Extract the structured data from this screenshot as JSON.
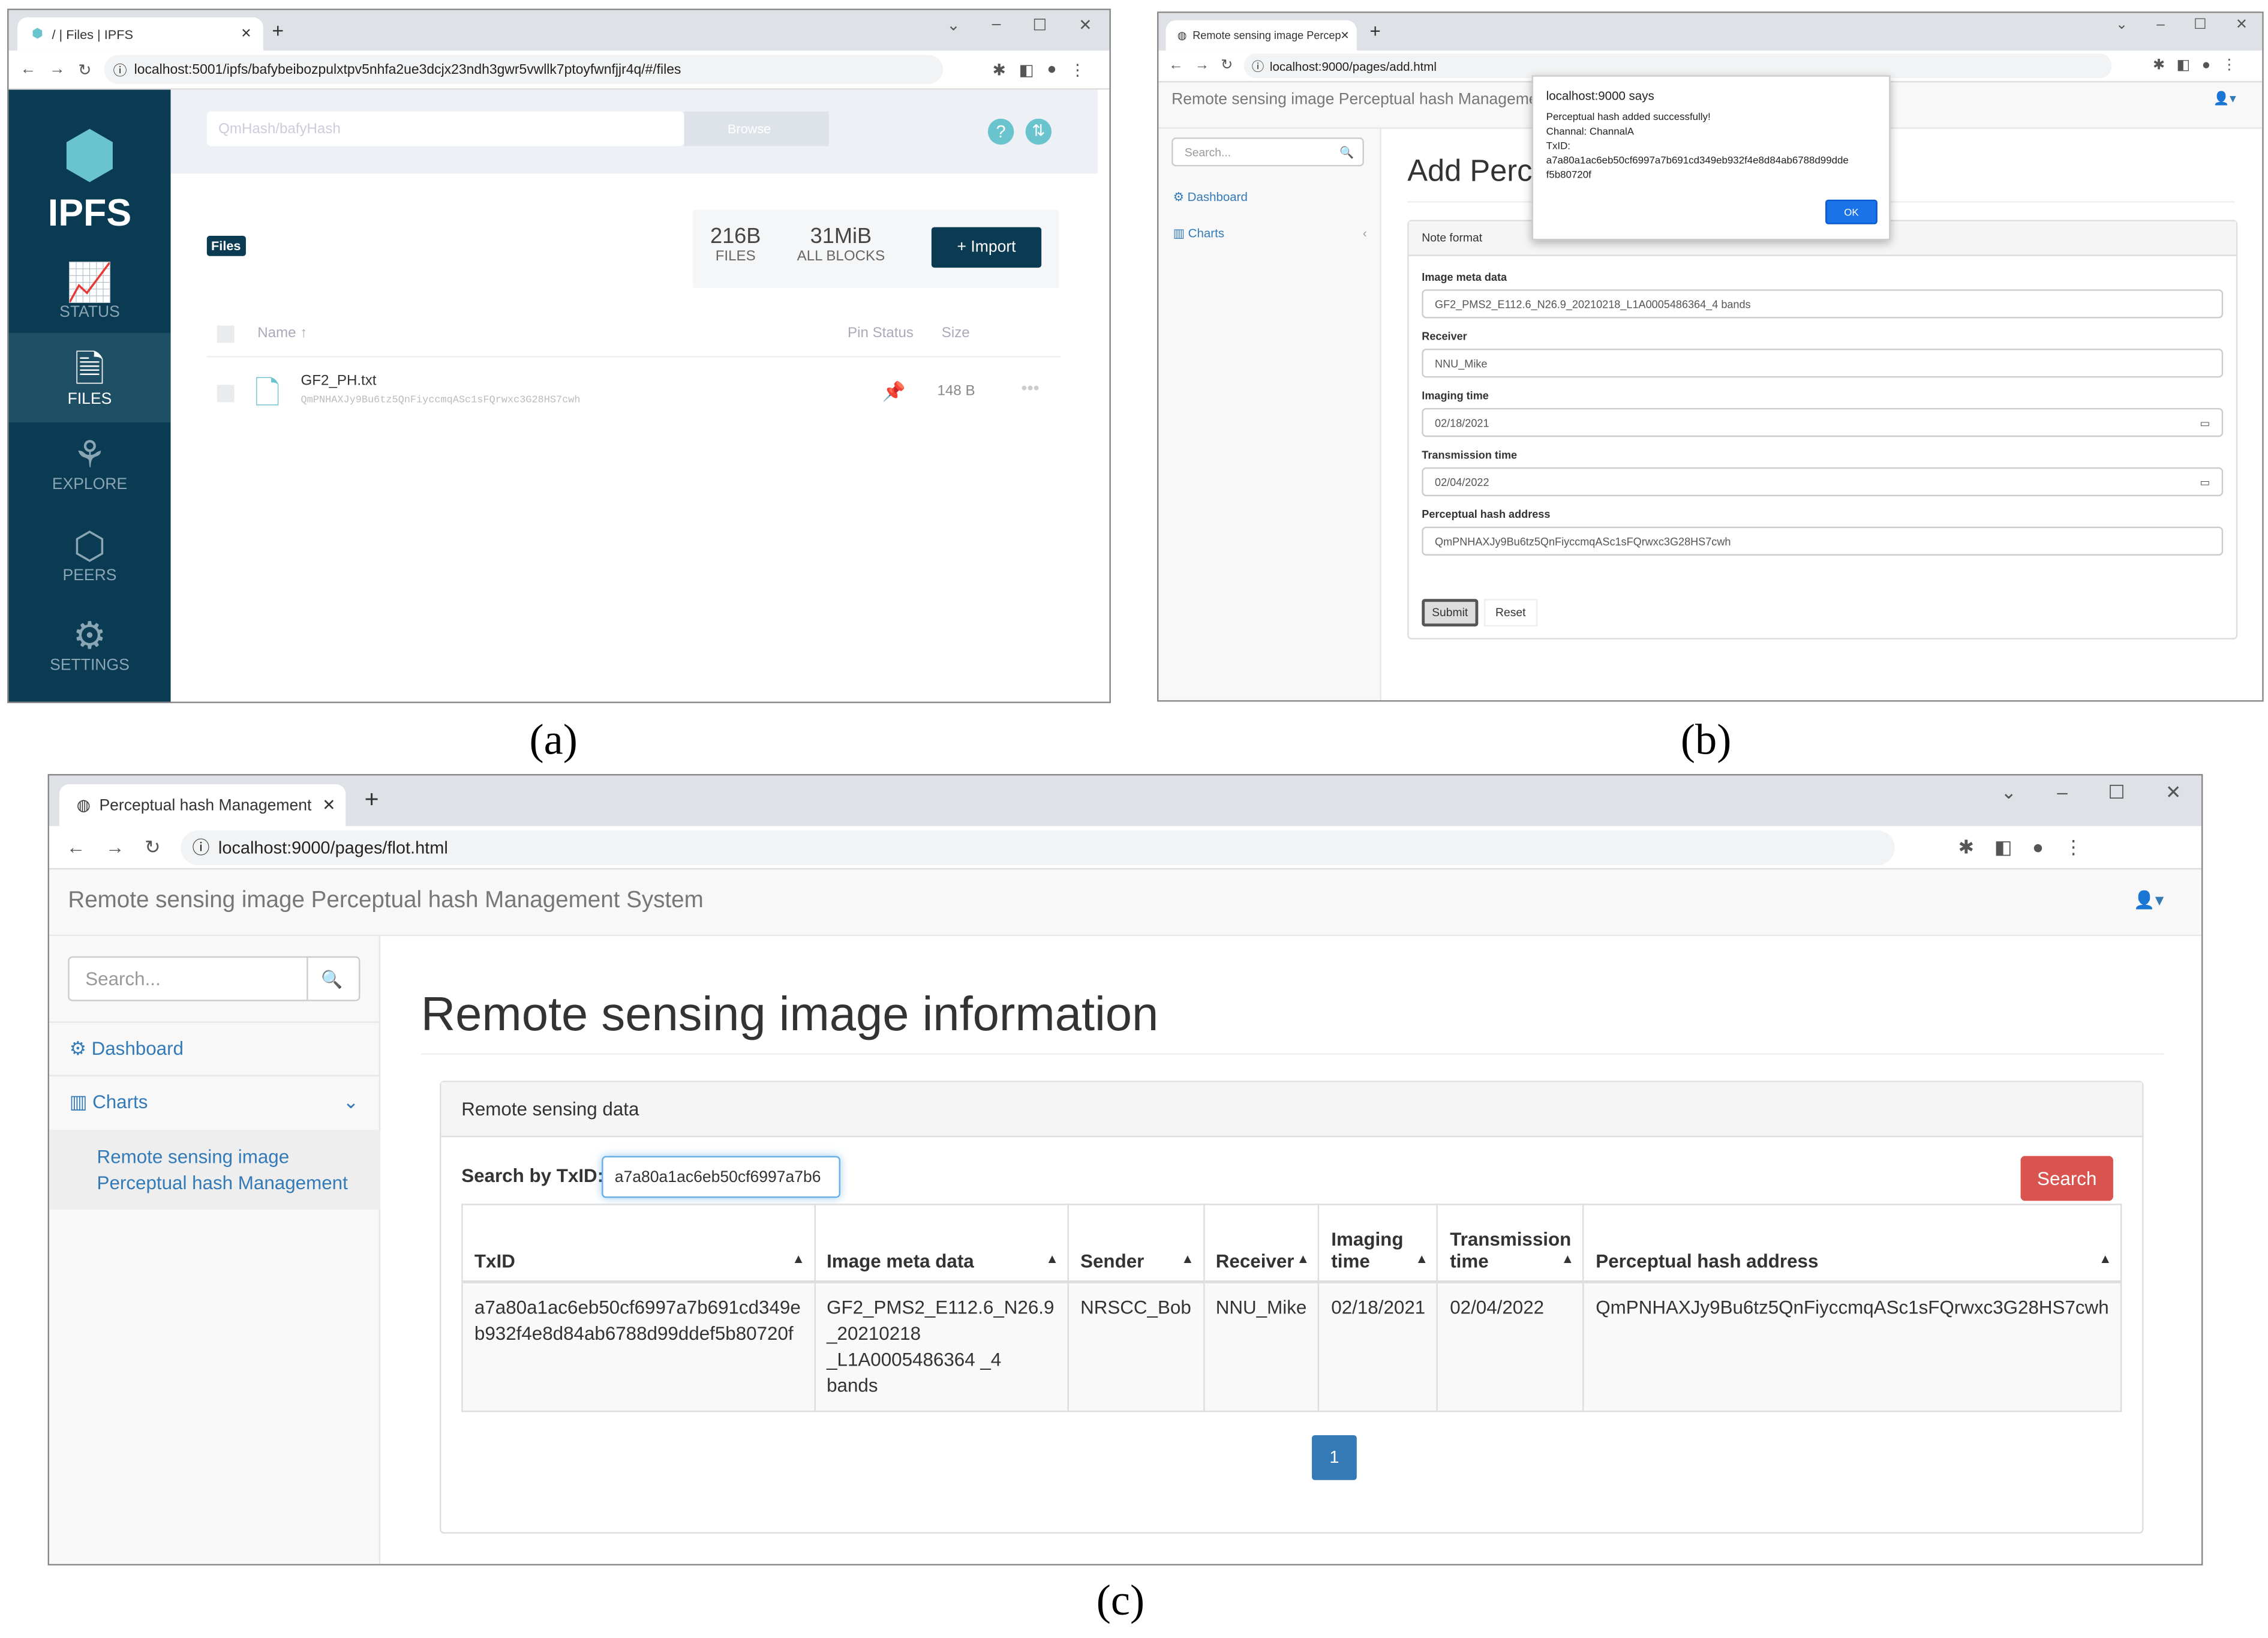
{
  "captions": {
    "a": "(a)",
    "b": "(b)",
    "c": "(c)"
  },
  "panel_a": {
    "tab_title": "/ | Files | IPFS",
    "url": "localhost:5001/ipfs/bafybeibozpulxtpv5nhfa2ue3dcjx23ndh3gwr5vwllk7ptoyfwnfjjr4q/#/files",
    "search_placeholder": "QmHash/bafyHash",
    "browse_label": "Browse",
    "logo_text": "IPFS",
    "nav": [
      {
        "label": "STATUS",
        "icon": "status-icon"
      },
      {
        "label": "FILES",
        "icon": "files-icon"
      },
      {
        "label": "EXPLORE",
        "icon": "explore-icon"
      },
      {
        "label": "PEERS",
        "icon": "peers-icon"
      },
      {
        "label": "SETTINGS",
        "icon": "settings-icon"
      }
    ],
    "breadcrumb": "Files",
    "stats": [
      {
        "value": "216B",
        "label": "FILES"
      },
      {
        "value": "31MiB",
        "label": "ALL BLOCKS"
      }
    ],
    "import_label": "+ Import",
    "columns": {
      "name": "Name ↑",
      "pin": "Pin Status",
      "size": "Size"
    },
    "file": {
      "name": "GF2_PH.txt",
      "cid": "QmPNHAXJy9Bu6tz5QnFiyccmqASc1sFQrwxc3G28HS7cwh",
      "size": "148 B"
    }
  },
  "panel_b": {
    "tab_title": "Remote sensing image Percep",
    "url": "localhost:9000/pages/add.html",
    "app_title": "Remote sensing image Perceptual hash Management System",
    "search_placeholder": "Search...",
    "sidebar": {
      "dashboard": "Dashboard",
      "charts": "Charts"
    },
    "page_heading": "Add Perceptual hash",
    "panel_heading": "Note format",
    "fields": [
      {
        "label": "Image meta data",
        "value": "GF2_PMS2_E112.6_N26.9_20210218_L1A0005486364_4 bands"
      },
      {
        "label": "Receiver",
        "value": "NNU_Mike"
      },
      {
        "label": "Imaging time",
        "value": "02/18/2021"
      },
      {
        "label": "Transmission time",
        "value": "02/04/2022"
      },
      {
        "label": "Perceptual hash address",
        "value": "QmPNHAXJy9Bu6tz5QnFiyccmqASc1sFQrwxc3G28HS7cwh"
      }
    ],
    "submit_label": "Submit",
    "reset_label": "Reset",
    "dialog": {
      "title": "localhost:9000 says",
      "line1": "Perceptual hash added successfully!",
      "line2": "Channal:  ChannalA",
      "line3": "TxID:",
      "line4": "a7a80a1ac6eb50cf6997a7b691cd349eb932f4e8d84ab6788d99dde",
      "line5": "f5b80720f",
      "ok_label": "OK"
    }
  },
  "panel_c": {
    "tab_title": "Perceptual hash Management",
    "url": "localhost:9000/pages/flot.html",
    "app_title": "Remote sensing image Perceptual hash Management System",
    "search_placeholder": "Search...",
    "sidebar": {
      "dashboard": "Dashboard",
      "charts": "Charts",
      "sub1": "Remote sensing image",
      "sub2": "Perceptual hash Management"
    },
    "page_heading": "Remote sensing image information",
    "panel_heading": "Remote sensing data",
    "search_label": "Search by TxID:",
    "search_value": "a7a80a1ac6eb50cf6997a7b6",
    "search_button": "Search",
    "columns": [
      "TxID",
      "Image meta data",
      "Sender",
      "Receiver",
      "Imaging time",
      "Transmission time",
      "Perceptual hash address"
    ],
    "row": {
      "txid1": "a7a80a1ac6eb50cf6997a7b691cd349e",
      "txid2": "b932f4e8d84ab6788d99ddef5b80720f",
      "meta1": "GF2_PMS2_E112.6_N26.9",
      "meta2": "_20210218",
      "meta3": "_L1A0005486364 _4 bands",
      "sender": "NRSCC_Bob",
      "receiver": "NNU_Mike",
      "imaging": "02/18/2021",
      "transmission": "02/04/2022",
      "hash": "QmPNHAXJy9Bu6tz5QnFiyccmqASc1sFQrwxc3G28HS7cwh"
    },
    "page": "1"
  },
  "colors": {
    "ipfs_navy": "#0b3a53",
    "ipfs_teal": "#69c4cd",
    "link_blue": "#337ab7",
    "danger": "#d9534f",
    "primary": "#1a73e8"
  }
}
